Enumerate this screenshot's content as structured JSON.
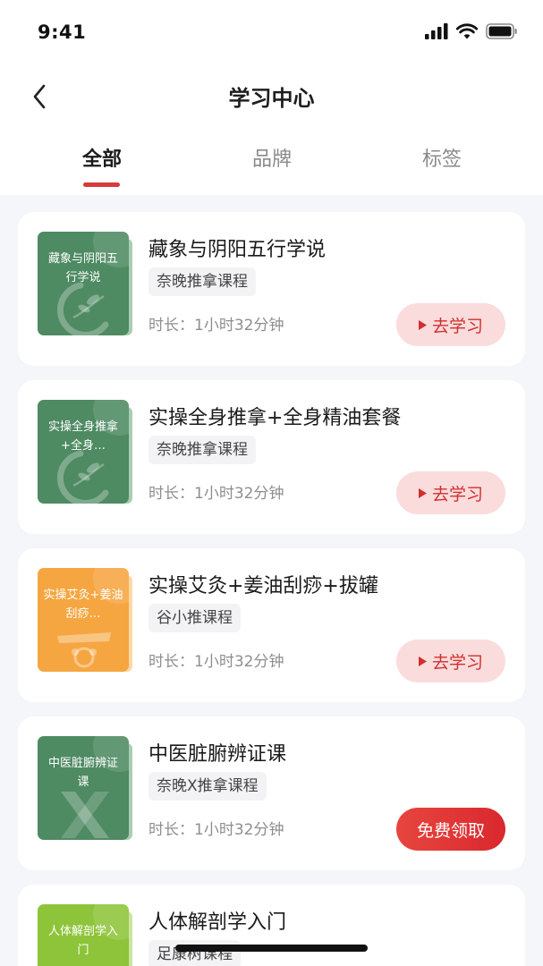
{
  "status_bar": {
    "time": "9:41"
  },
  "nav": {
    "title": "学习中心"
  },
  "tabs": [
    {
      "label": "全部",
      "active": true
    },
    {
      "label": "品牌",
      "active": false
    },
    {
      "label": "标签",
      "active": false
    }
  ],
  "colors": {
    "accent": "#d63a3a",
    "cover_green": "#4e8a62",
    "cover_orange": "#f6a640",
    "cover_lime": "#8ec43a"
  },
  "courses": [
    {
      "cover_text": "藏象与阴阳五行学说",
      "title": "藏象与阴阳五行学说",
      "tag": "奈晚推拿课程",
      "duration": "时长：1小时32分钟",
      "action": "去学习",
      "action_type": "study",
      "cover_color": "green",
      "cover_icon": "leaf-icon"
    },
    {
      "cover_text": "实操全身推拿+全身…",
      "title": "实操全身推拿+全身精油套餐",
      "tag": "奈晚推拿课程",
      "duration": "时长：1小时32分钟",
      "action": "去学习",
      "action_type": "study",
      "cover_color": "green",
      "cover_icon": "leaf-icon"
    },
    {
      "cover_text": "实操艾灸+姜油刮痧…",
      "title": "实操艾灸+姜油刮痧+拔罐",
      "tag": "谷小推课程",
      "duration": "时长：1小时32分钟",
      "action": "去学习",
      "action_type": "study",
      "cover_color": "orange",
      "cover_icon": "mascot-icon"
    },
    {
      "cover_text": "中医脏腑辨证课",
      "title": "中医脏腑辨证课",
      "tag": "奈晚X推拿课程",
      "duration": "时长：1小时32分钟",
      "action": "免费领取",
      "action_type": "free",
      "cover_color": "green",
      "cover_icon": "x-logo-icon"
    },
    {
      "cover_text": "人体解剖学入门",
      "title": "人体解剖学入门",
      "tag": "足康树课程",
      "cover_color": "lime"
    }
  ]
}
